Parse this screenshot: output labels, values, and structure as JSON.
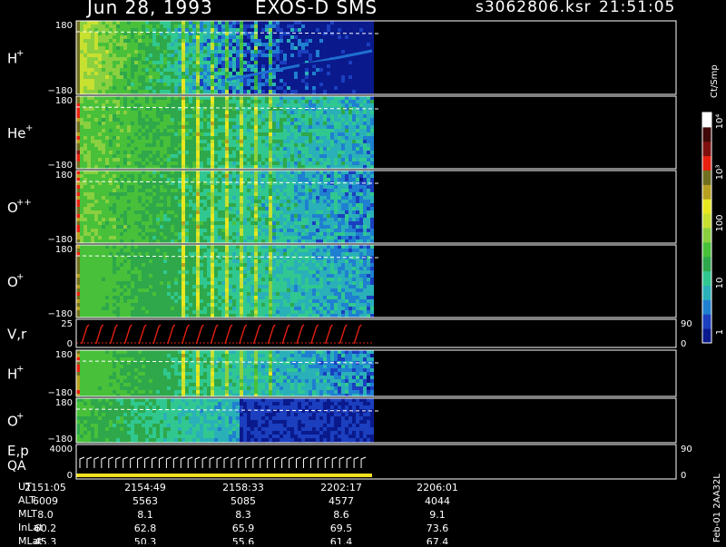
{
  "header": {
    "date": "Jun 28, 1993",
    "instrument": "EXOS-D SMS",
    "file": "s3062806.ksr",
    "time": "21:51:05"
  },
  "colorbar": {
    "unit": "Ct/Smp",
    "ticks": [
      "1",
      "10",
      "100",
      "10³",
      "10⁴"
    ],
    "colors": [
      "#0a1a8c",
      "#1b3fbf",
      "#1f7fd0",
      "#2ab0b8",
      "#30c890",
      "#2ea84a",
      "#48c03a",
      "#8ad040",
      "#c8e030",
      "#e8e820",
      "#b8a020",
      "#707020",
      "#e82010",
      "#801010",
      "#400808",
      "#ffffff"
    ]
  },
  "panels": [
    {
      "name": "H+",
      "label": "H",
      "sup": "+",
      "ymax": "180",
      "ymin": "−180"
    },
    {
      "name": "He+",
      "label": "He",
      "sup": "+",
      "ymax": "180",
      "ymin": "−180"
    },
    {
      "name": "O++",
      "label": "O",
      "sup": "++",
      "ymax": "180",
      "ymin": "−180"
    },
    {
      "name": "O+",
      "label": "O",
      "sup": "+",
      "ymax": "180",
      "ymin": "−180"
    },
    {
      "name": "V,r",
      "label": "V,r",
      "sup": "",
      "ymax": "25",
      "ymin": "0",
      "rmax": "90",
      "rmin": "0"
    },
    {
      "name": "H+ (2)",
      "label": "H",
      "sup": "+",
      "ymax": "180",
      "ymin": "−180"
    },
    {
      "name": "O+ (2)",
      "label": "O",
      "sup": "+",
      "ymax": "180",
      "ymin": "−180"
    },
    {
      "name": "E,p QA",
      "label": "E,p",
      "label2": "QA",
      "sup": "",
      "ymax": "4000",
      "ymin": "0",
      "rmax": "90",
      "rmin": "0"
    }
  ],
  "chart_data": {
    "type": "heatmap",
    "title": "Jun 28, 1993   EXOS-D SMS",
    "x": [
      "2151:05",
      "2154:49",
      "2158:33",
      "2202:17",
      "2206:01"
    ],
    "rows": [
      {
        "name": "UT",
        "values": [
          "2151:05",
          "2154:49",
          "2158:33",
          "2202:17",
          "2206:01"
        ]
      },
      {
        "name": "ALT",
        "values": [
          "6009",
          "5563",
          "5085",
          "4577",
          "4044"
        ]
      },
      {
        "name": "MLT",
        "values": [
          "8.0",
          "8.1",
          "8.3",
          "8.6",
          "9.1"
        ]
      },
      {
        "name": "InLat",
        "values": [
          "60.2",
          "62.8",
          "65.9",
          "69.5",
          "73.6"
        ]
      },
      {
        "name": "MLat",
        "values": [
          "45.3",
          "50.3",
          "55.6",
          "61.4",
          "67.4"
        ]
      }
    ],
    "colorbar_range": [
      1,
      10000
    ],
    "colorbar_scale": "log"
  },
  "footer": {
    "label": "Feb-01 2AA32L"
  }
}
